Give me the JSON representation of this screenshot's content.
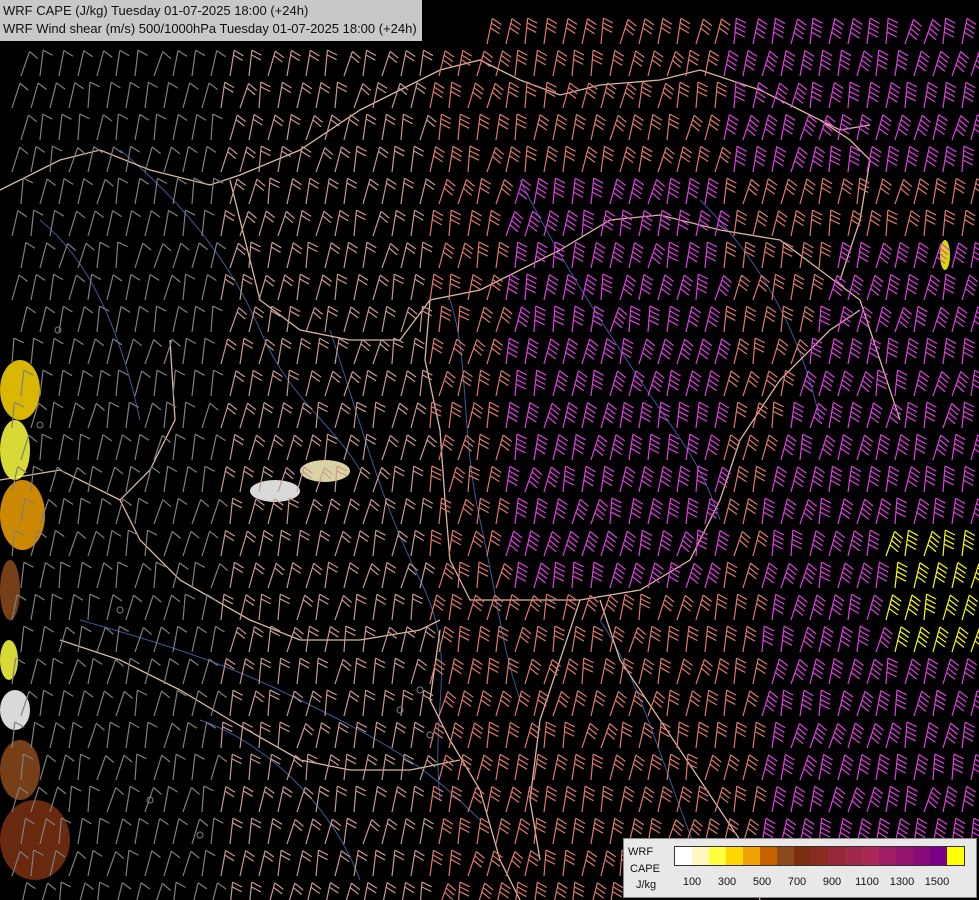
{
  "title": {
    "line1": "WRF CAPE (J/kg) Tuesday 01-07-2025 18:00 (+24h)",
    "line2": "WRF Wind shear (m/s) 500/1000hPa Tuesday 01-07-2025 18:00 (+24h)"
  },
  "legend": {
    "model": "WRF",
    "field": "CAPE",
    "unit": "J/kg",
    "ticks": [
      "100",
      "300",
      "500",
      "700",
      "900",
      "1100",
      "1300",
      "1500"
    ],
    "colors": [
      "#ffffff",
      "#fff7c0",
      "#ffff40",
      "#ffd700",
      "#f0a000",
      "#c86400",
      "#8c4a1c",
      "#7a3010",
      "#8a2a20",
      "#96283a",
      "#a02848",
      "#aa2858",
      "#a01e64",
      "#961470",
      "#8a0a7c",
      "#7a0088",
      "#ffff00"
    ]
  },
  "map": {
    "background": "#000000",
    "border_color": "#d8b8a0",
    "river_color": "#3a5a9a",
    "barb_colors": {
      "weak": "#808080",
      "moderate": "#c89a90",
      "strong": "#e07a6a",
      "very_strong": "#e040e0",
      "extreme": "#ffff00"
    },
    "icons": [
      "wind-barb-icon",
      "calm-circle-icon"
    ]
  }
}
